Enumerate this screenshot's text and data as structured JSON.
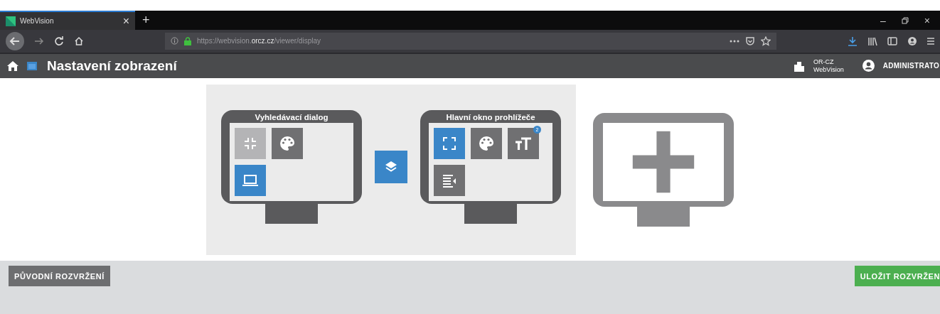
{
  "browser": {
    "tab": {
      "title": "WebVision",
      "close": "×"
    },
    "new_tab": "+",
    "url": {
      "scheme": "https://webvision.",
      "domain": "orcz.cz",
      "path": "/viewer/display"
    },
    "window_controls": [
      "–",
      "×"
    ]
  },
  "header": {
    "title": "Nastavení zobrazení",
    "org": [
      "OR-CZ",
      "WebVision"
    ],
    "user": "ADMINISTRATO"
  },
  "monitors": [
    {
      "title": "Vyhledávací dialog",
      "rows": [
        [
          {
            "kind": "collapse",
            "selected": false,
            "disabled": true
          },
          {
            "kind": "palette",
            "selected": false,
            "disabled": false
          }
        ],
        [
          {
            "kind": "laptop",
            "selected": true,
            "disabled": false
          }
        ]
      ]
    },
    {
      "title": "Hlavní okno prohlížeče",
      "rows": [
        [
          {
            "kind": "expand",
            "selected": true,
            "disabled": false
          },
          {
            "kind": "palette",
            "selected": false,
            "disabled": false
          },
          {
            "kind": "textsize",
            "selected": false,
            "disabled": false,
            "badge": "2"
          }
        ],
        [
          {
            "kind": "panel",
            "selected": false,
            "disabled": false
          }
        ]
      ]
    }
  ],
  "buttons": {
    "reset": "PŮVODNÍ ROZVRŽENÍ",
    "save": "ULOŽIT ROZVRŽEN"
  }
}
